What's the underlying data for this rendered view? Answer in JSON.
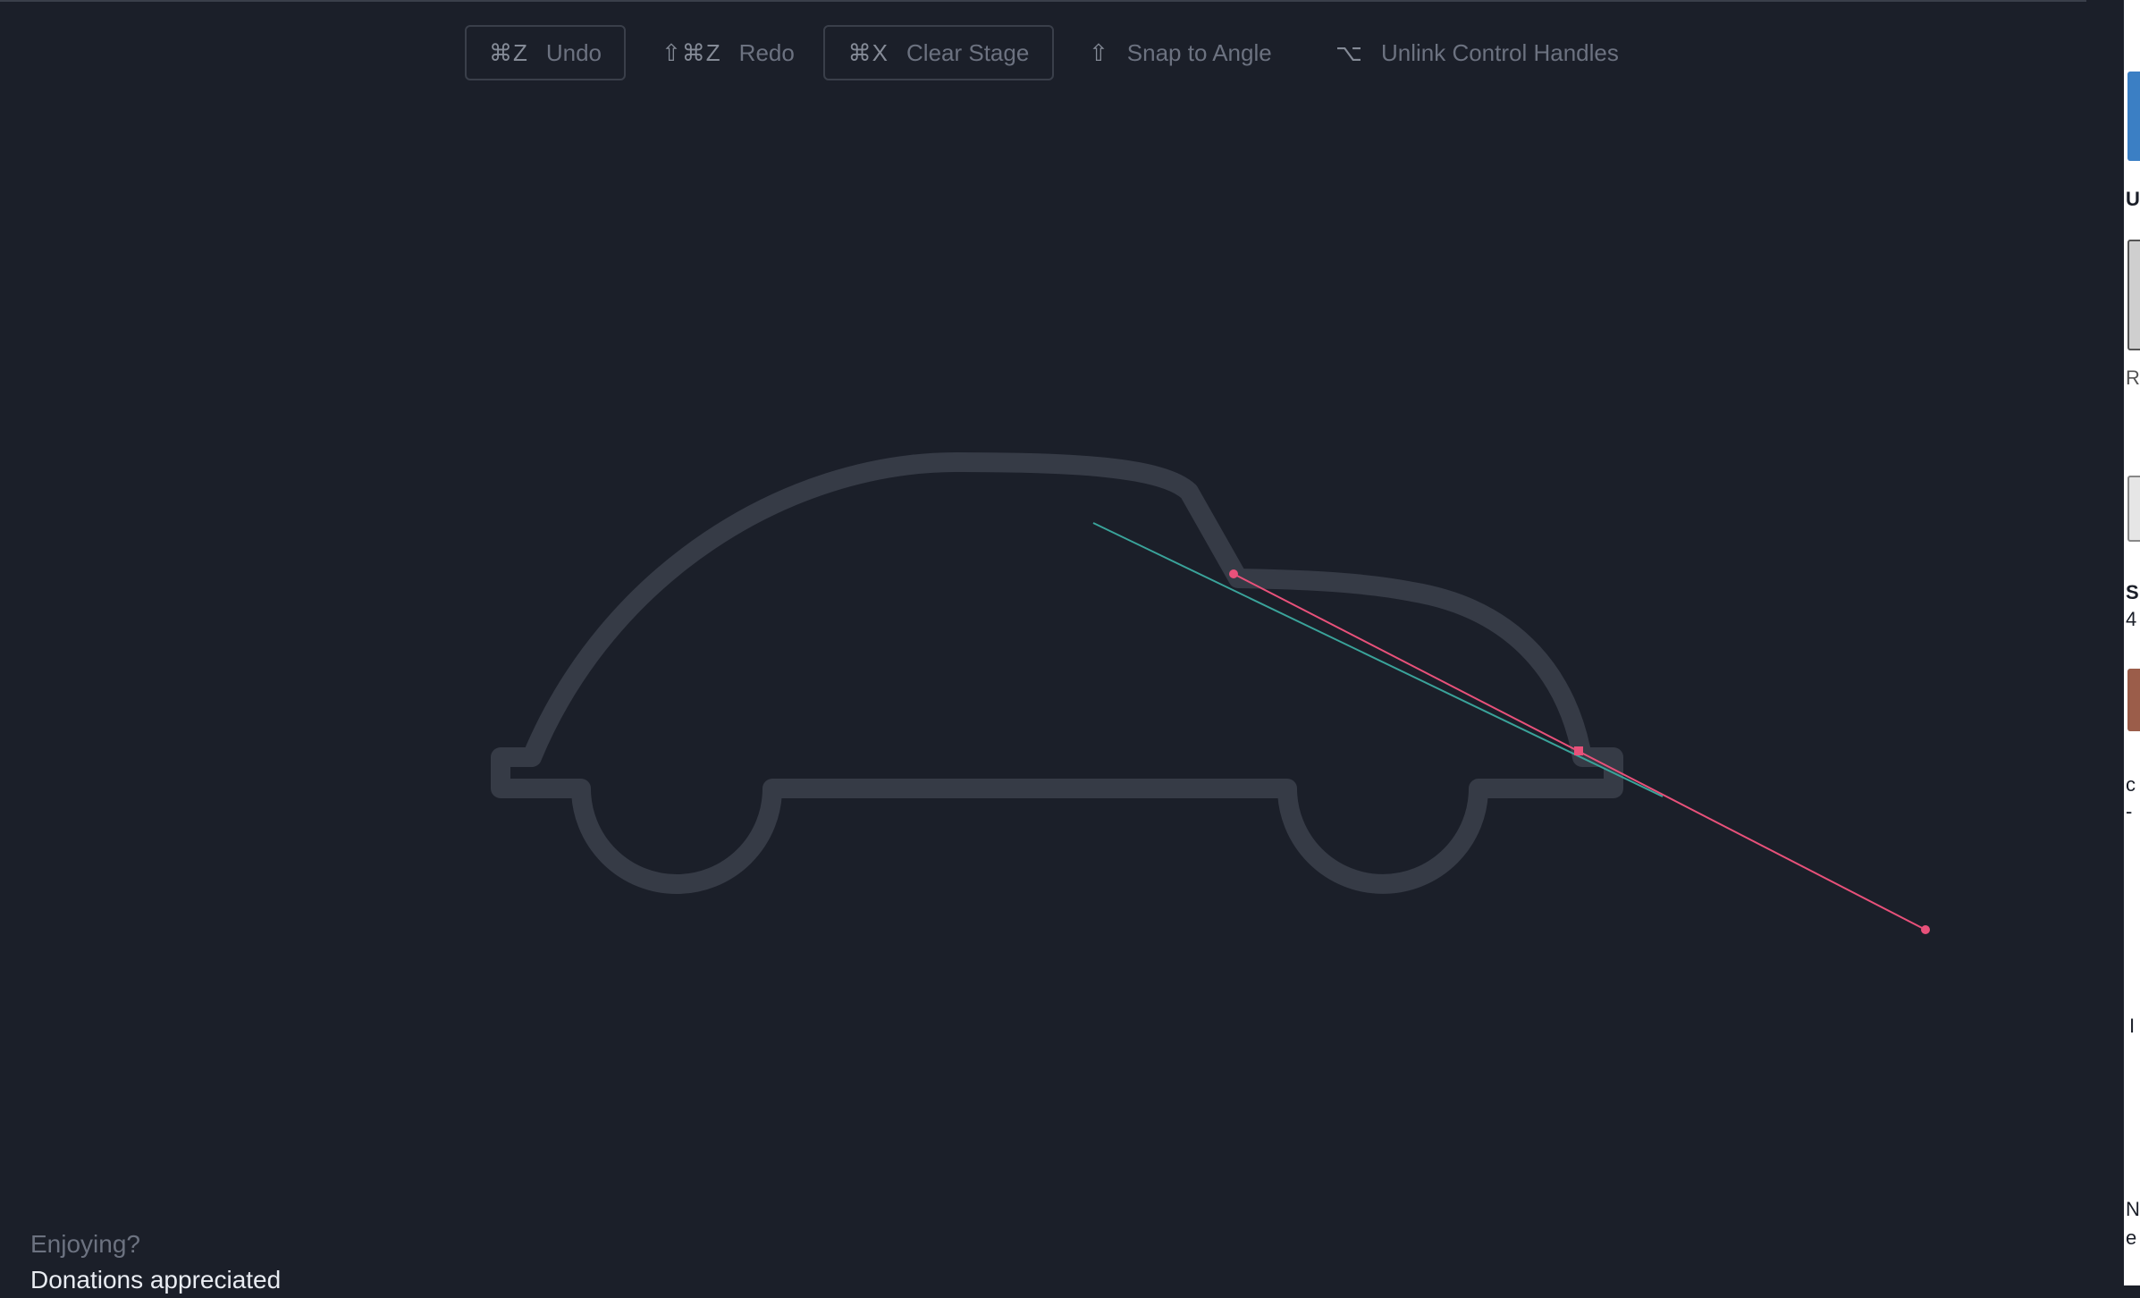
{
  "toolbar": {
    "undo": {
      "key": "⌘Z",
      "label": "Undo"
    },
    "redo": {
      "key": "⇧⌘Z",
      "label": "Redo"
    },
    "clear": {
      "key": "⌘X",
      "label": "Clear Stage"
    },
    "snap": {
      "key": "⇧",
      "label": "Snap to Angle"
    },
    "unlink": {
      "key": "⌥",
      "label": "Unlink Control Handles"
    }
  },
  "footer": {
    "line1": "Enjoying?",
    "line2": "Donations appreciated"
  },
  "colors": {
    "background": "#1b1f29",
    "guide_shape": "#363b46",
    "bezier_path": "#e8517a",
    "control_handle": "#3aa39a"
  },
  "sidebar": {
    "fragments": [
      "U",
      "R",
      "S",
      "4",
      "c",
      "-",
      "I",
      "N",
      "e"
    ]
  }
}
